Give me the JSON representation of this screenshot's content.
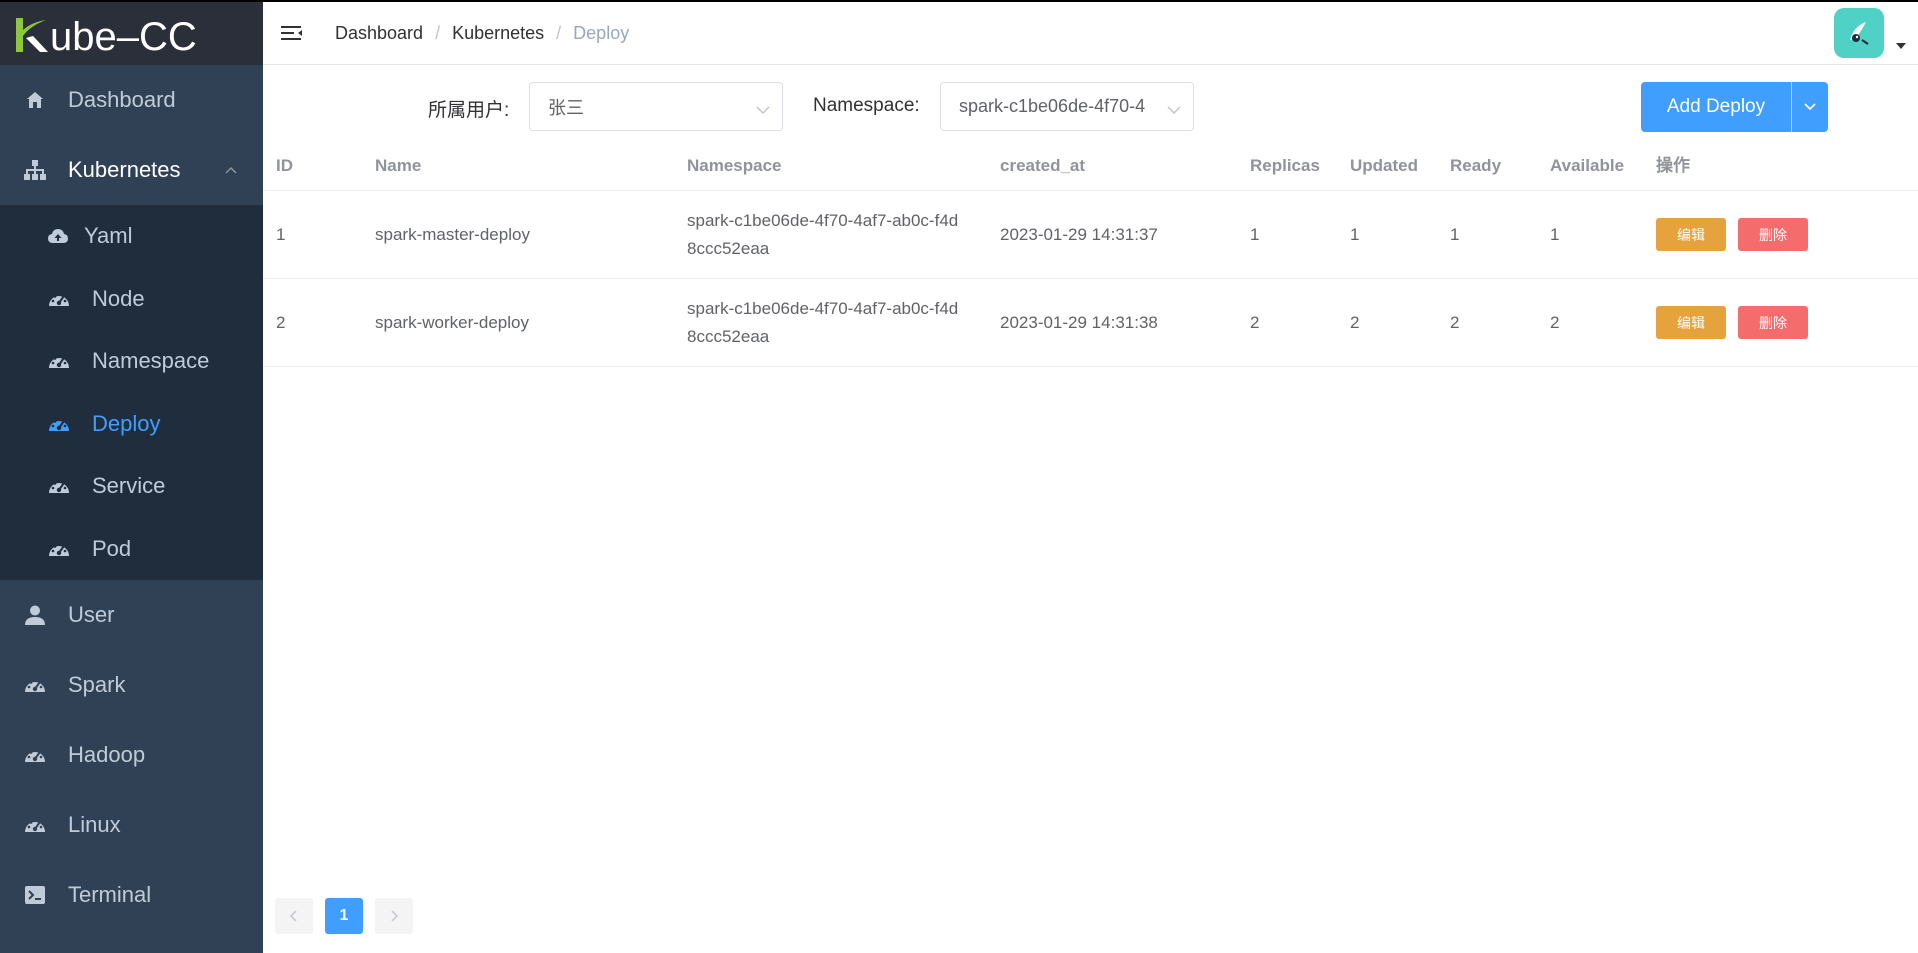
{
  "app": {
    "logo_text": "Kube-CC"
  },
  "sidebar": {
    "items": [
      {
        "label": "Dashboard",
        "icon": "home-icon"
      },
      {
        "label": "Kubernetes",
        "icon": "sitemap-icon"
      },
      {
        "label": "User",
        "icon": "user-icon"
      },
      {
        "label": "Spark",
        "icon": "dashboard-icon"
      },
      {
        "label": "Hadoop",
        "icon": "dashboard-icon"
      },
      {
        "label": "Linux",
        "icon": "dashboard-icon"
      },
      {
        "label": "Terminal",
        "icon": "terminal-icon"
      }
    ],
    "submenu": [
      {
        "label": "Yaml",
        "icon": "cloud-upload-icon"
      },
      {
        "label": "Node",
        "icon": "dashboard-icon"
      },
      {
        "label": "Namespace",
        "icon": "dashboard-icon"
      },
      {
        "label": "Deploy",
        "icon": "dashboard-icon"
      },
      {
        "label": "Service",
        "icon": "dashboard-icon"
      },
      {
        "label": "Pod",
        "icon": "dashboard-icon"
      }
    ],
    "active": "Deploy"
  },
  "breadcrumb": [
    "Dashboard",
    "Kubernetes",
    "Deploy"
  ],
  "filter": {
    "user_label": "所属用户:",
    "user_value": "张三",
    "namespace_label": "Namespace:",
    "namespace_value": "spark-c1be06de-4f70-4",
    "add_button": "Add Deploy"
  },
  "table": {
    "headers": [
      "ID",
      "Name",
      "Namespace",
      "created_at",
      "Replicas",
      "Updated",
      "Ready",
      "Available",
      "操作"
    ],
    "rows": [
      {
        "id": "1",
        "name": "spark-master-deploy",
        "namespace_line1": "spark-c1be06de-4f70-4af7-ab0c-f4d",
        "namespace_line2": "8ccc52eaa",
        "created_at": "2023-01-29 14:31:37",
        "replicas": "1",
        "updated": "1",
        "ready": "1",
        "available": "1"
      },
      {
        "id": "2",
        "name": "spark-worker-deploy",
        "namespace_line1": "spark-c1be06de-4f70-4af7-ab0c-f4d",
        "namespace_line2": "8ccc52eaa",
        "created_at": "2023-01-29 14:31:38",
        "replicas": "2",
        "updated": "2",
        "ready": "2",
        "available": "2"
      }
    ],
    "edit_label": "编辑",
    "delete_label": "删除"
  },
  "pagination": {
    "current": "1"
  },
  "colors": {
    "sidebar_bg": "#304156",
    "submenu_bg": "#1f2d3d",
    "primary": "#409eff",
    "warning": "#e6a23c",
    "danger": "#f56c6c",
    "logo_green": "#8dc63f"
  }
}
